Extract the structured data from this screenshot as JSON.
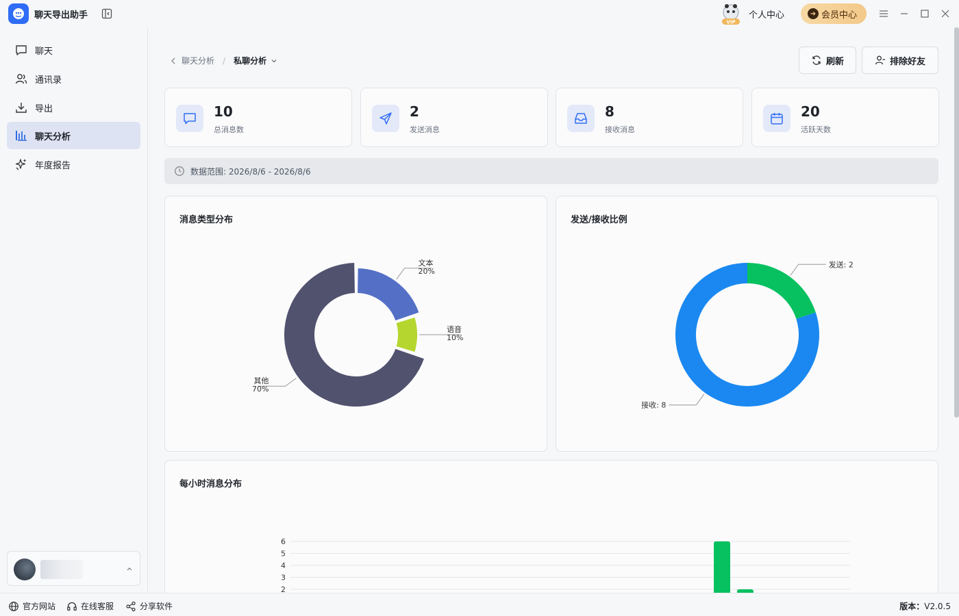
{
  "app": {
    "title": "聊天导出助手"
  },
  "header": {
    "personal_center": "个人中心",
    "member_center": "会员中心"
  },
  "sidebar": {
    "items": [
      {
        "label": "聊天",
        "icon": "chat-icon"
      },
      {
        "label": "通讯录",
        "icon": "contacts-icon"
      },
      {
        "label": "导出",
        "icon": "download-icon"
      },
      {
        "label": "聊天分析",
        "icon": "bar-chart-icon",
        "active": true
      },
      {
        "label": "年度报告",
        "icon": "sparkle-icon"
      }
    ]
  },
  "breadcrumb": {
    "parent": "聊天分析",
    "current": "私聊分析"
  },
  "toolbar": {
    "refresh_label": "刷新",
    "exclude_label": "排除好友"
  },
  "stats": [
    {
      "value": "10",
      "label": "总消息数",
      "icon": "message-icon"
    },
    {
      "value": "2",
      "label": "发送消息",
      "icon": "send-icon"
    },
    {
      "value": "8",
      "label": "接收消息",
      "icon": "inbox-icon"
    },
    {
      "value": "20",
      "label": "活跃天数",
      "icon": "calendar-icon"
    }
  ],
  "range": {
    "text": "数据范围: 2026/8/6 - 2026/8/6"
  },
  "panels": {
    "type_title": "消息类型分布",
    "ratio_title": "发送/接收比例",
    "hourly_title": "每小时消息分布"
  },
  "colors": {
    "accent": "#2f6df6",
    "text_slice": "#5470c6",
    "voice_slice": "#b5d62e",
    "other_slice": "#50526e",
    "send": "#07c160",
    "receive": "#1a88f0"
  },
  "chart_data": [
    {
      "type": "pie",
      "title": "消息类型分布",
      "slices": [
        {
          "name": "文本",
          "value": 20,
          "label": "20%"
        },
        {
          "name": "语音",
          "value": 10,
          "label": "10%"
        },
        {
          "name": "其他",
          "value": 70,
          "label": "70%"
        }
      ]
    },
    {
      "type": "pie",
      "title": "发送/接收比例",
      "slices": [
        {
          "name": "发送",
          "value": 2,
          "label": "发送: 2"
        },
        {
          "name": "接收",
          "value": 8,
          "label": "接收: 8"
        }
      ]
    },
    {
      "type": "bar",
      "title": "每小时消息分布",
      "y_ticks": [
        "6",
        "5",
        "4",
        "3",
        "2"
      ],
      "ylim": [
        0,
        6
      ],
      "values": [
        6,
        2
      ]
    }
  ],
  "footer": {
    "website": "官方网站",
    "support": "在线客服",
    "share": "分享软件",
    "version_label": "版本：",
    "version_value": "V2.0.5"
  }
}
